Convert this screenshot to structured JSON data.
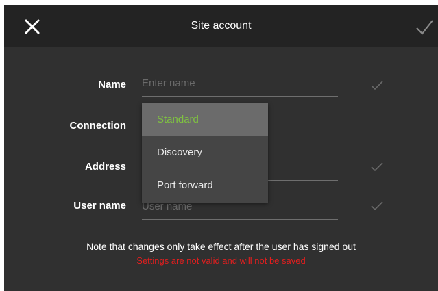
{
  "header": {
    "title": "Site account",
    "close_icon": "close-icon",
    "confirm_icon": "checkmark-icon"
  },
  "form": {
    "name": {
      "label": "Name",
      "placeholder": "Enter name",
      "valid_icon": "checkmark-icon"
    },
    "connection": {
      "label": "Connection"
    },
    "address": {
      "label": "Address",
      "valid_icon": "checkmark-icon"
    },
    "username": {
      "label": "User name",
      "placeholder": "User name",
      "valid_icon": "checkmark-icon"
    }
  },
  "dropdown": {
    "options": [
      "Standard",
      "Discovery",
      "Port forward"
    ],
    "selected": "Standard"
  },
  "footer": {
    "note": "Note that changes only take effect after the user has signed out",
    "warning": "Settings are not valid and will not be saved"
  },
  "colors": {
    "background": "#303030",
    "topbar": "#232323",
    "accent_green": "#7fc241",
    "error_red": "#e31e1e"
  }
}
